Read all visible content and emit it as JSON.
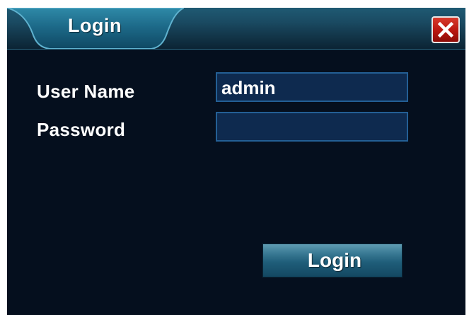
{
  "window": {
    "title": "Login",
    "close_icon": "close-x-icon"
  },
  "form": {
    "username_label": "User Name",
    "username_value": "admin",
    "password_label": "Password",
    "password_value": ""
  },
  "actions": {
    "login_label": "Login"
  },
  "colors": {
    "background": "#050f1e",
    "titlebar": "#1a4a62",
    "input_fill": "#0e2a4f",
    "input_border": "#245f95",
    "close_button": "#b8160f",
    "button": "#1f5e7a"
  }
}
